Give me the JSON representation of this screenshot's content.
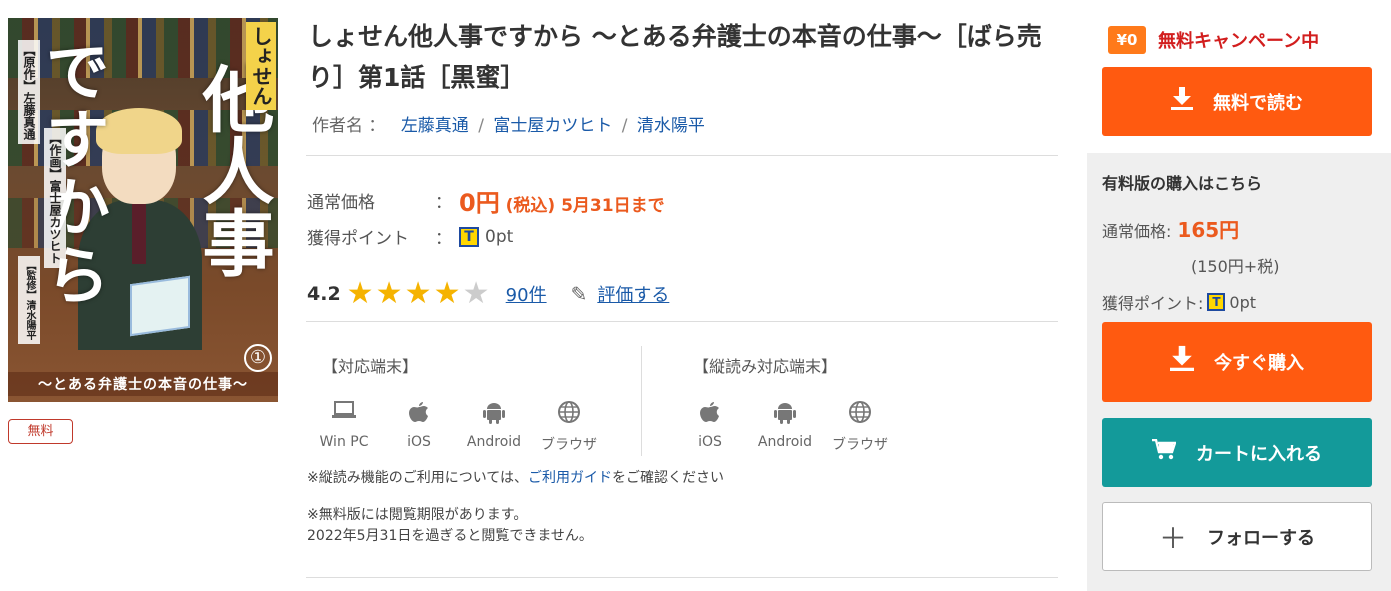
{
  "cover": {
    "title_de": "ですから",
    "title_tanin": "他人事",
    "title_shosen": "しょせん",
    "author1": "【原作】左藤真通",
    "author2": "【作画】富士屋カツヒト",
    "author3": "【監修】清水陽平",
    "volume": "①",
    "subtitle": "〜とある弁護士の本音の仕事〜"
  },
  "badge": {
    "free": "無料"
  },
  "title": "しょせん他人事ですから 〜とある弁護士の本音の仕事〜［ばら売り］第1話［黒蜜］",
  "authors": {
    "label": "作者名 ：",
    "names": [
      "左藤真通",
      "富士屋カツヒト",
      "清水陽平"
    ],
    "separator": "/"
  },
  "price": {
    "label": "通常価格",
    "colon": "：",
    "amount": "0円",
    "tax": "(税込)",
    "deadline": "5月31日まで"
  },
  "points": {
    "label": "獲得ポイント",
    "colon": "：",
    "value": "0pt",
    "icon": "T"
  },
  "rating": {
    "score": "4.2",
    "stars": 4.2,
    "count": "90件",
    "review_label": "評価する"
  },
  "devices": {
    "header": "【対応端末】",
    "items": [
      {
        "icon": "laptop-icon",
        "label": "Win PC"
      },
      {
        "icon": "apple-icon",
        "label": "iOS"
      },
      {
        "icon": "android-icon",
        "label": "Android"
      },
      {
        "icon": "globe-icon",
        "label": "ブラウザ"
      }
    ]
  },
  "vertical_devices": {
    "header": "【縦読み対応端末】",
    "items": [
      {
        "icon": "apple-icon",
        "label": "iOS"
      },
      {
        "icon": "android-icon",
        "label": "Android"
      },
      {
        "icon": "globe-icon",
        "label": "ブラウザ"
      }
    ]
  },
  "notes": {
    "vertical_pre": "※縦読み機能のご利用については、",
    "vertical_link": "ご利用ガイド",
    "vertical_post": "をご確認ください",
    "free_line1": "※無料版には閲覧期限があります。",
    "free_line2": "2022年5月31日を過ぎると閲覧できません。"
  },
  "sidebar": {
    "campaign_yen": "¥0",
    "campaign_text": "無料キャンペーン中",
    "read_free": "無料で読む",
    "paid_title": "有料版の購入はこちら",
    "paid_price_label": "通常価格:",
    "paid_price": "165円",
    "paid_tax": "(150円+税)",
    "paid_point_label": "獲得ポイント:",
    "paid_point": "0pt",
    "buy_now": "今すぐ購入",
    "add_cart": "カートに入れる",
    "follow": "フォローする"
  },
  "colors": {
    "accent_orange": "#ff5a10",
    "price_red": "#eb5a1e",
    "campaign_red": "#d21e1e",
    "teal": "#139a9a",
    "link_blue": "#1a5aa8",
    "star_gold": "#f5b301"
  }
}
